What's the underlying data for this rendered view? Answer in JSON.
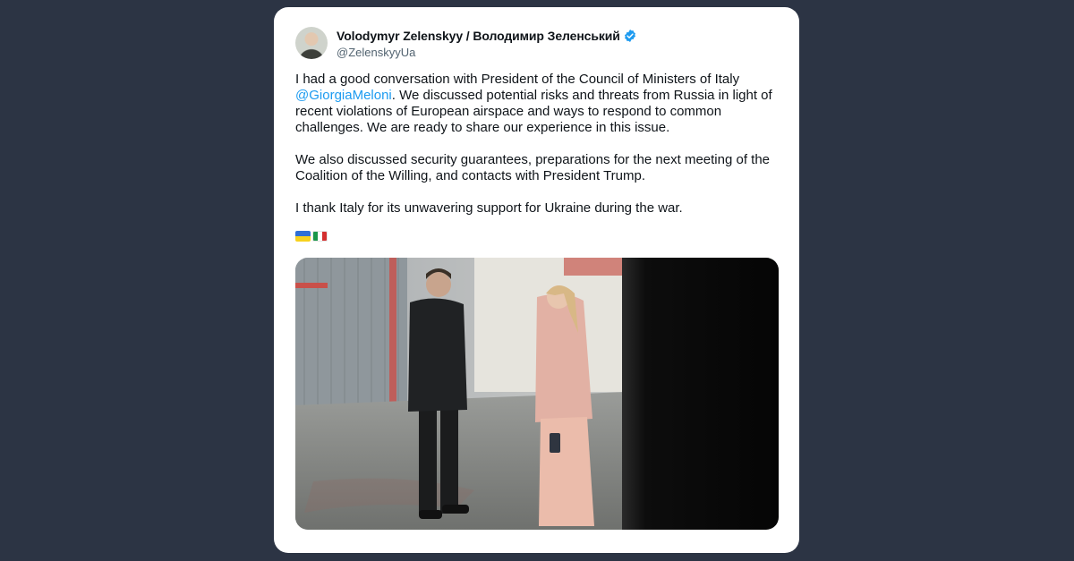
{
  "tweet": {
    "author_name": "Volodymyr Zelenskyy / Володимир Зеленський",
    "author_handle": "@ZelenskyyUa",
    "paragraph1_before": "I had a good conversation with President of the Council of Ministers of Italy ",
    "mention": "@GiorgiaMeloni",
    "paragraph1_after": ". We discussed potential risks and threats from Russia in light of recent violations of European airspace and ways to respond to common challenges. We are ready to share our experience in this issue.",
    "paragraph2": "We also discussed security guarantees, preparations for the next meeting of the Coalition of the Willing, and contacts with President Trump.",
    "paragraph3": "I thank Italy for its unwavering support for Ukraine during the war.",
    "flags": [
      "ukraine-flag",
      "italy-flag"
    ],
    "colors": {
      "mention": "#1d9bf0",
      "verified": "#1d9bf0",
      "background": "#2c3444"
    }
  }
}
